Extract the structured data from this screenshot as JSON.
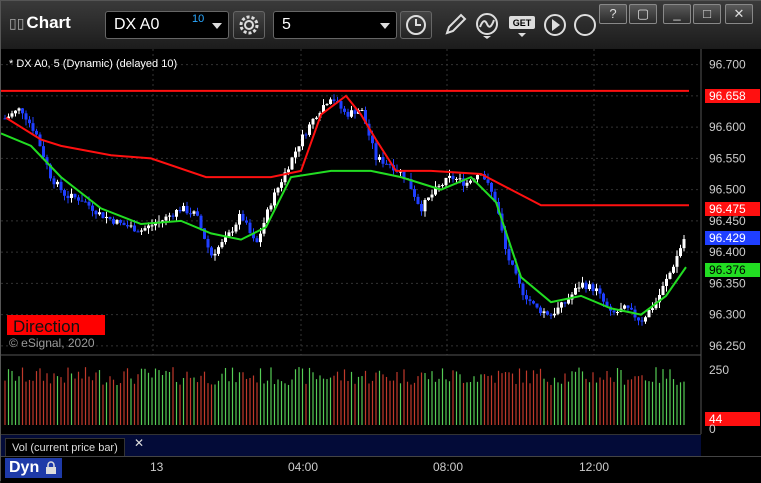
{
  "title": "Chart",
  "symbol": {
    "value": "DX A0",
    "delay": "10"
  },
  "interval": {
    "value": "5"
  },
  "study_title": "* DX A0, 5 (Dynamic) (delayed 10)",
  "direction_label": "Direction",
  "copyright": "© eSignal, 2020",
  "price_axis": {
    "ticks": [
      "96.700",
      "96.650",
      "96.600",
      "96.550",
      "96.500",
      "96.450",
      "96.400",
      "96.350",
      "96.300",
      "96.250"
    ],
    "ylim": [
      96.245,
      96.725
    ]
  },
  "price_badges": {
    "red_high": "96.658",
    "red_low": "96.475",
    "last": "96.429",
    "green": "96.376"
  },
  "volume_axis": {
    "ticks": [
      "250",
      "0"
    ],
    "badge": "44"
  },
  "volume_label": "Vol (current price bar)",
  "volume_close": "✕",
  "x_axis": {
    "labels": [
      "13",
      "04:00",
      "08:00",
      "12:00"
    ]
  },
  "mode_label": "Dyn",
  "colors": {
    "up": "#ffffff",
    "down": "#1f3fff",
    "red_line": "#ff1010",
    "green_line": "#22dd22",
    "vol_up": "#55cc55",
    "vol_down": "#c0392b"
  },
  "icons": {
    "settings": "gear-icon",
    "clock": "clock-icon",
    "pencil": "pencil-icon",
    "indicator": "curve-icon",
    "get": "get-icon",
    "play": "play-icon"
  },
  "window_buttons": [
    "?",
    "▢",
    "_",
    "□",
    "✕"
  ]
}
